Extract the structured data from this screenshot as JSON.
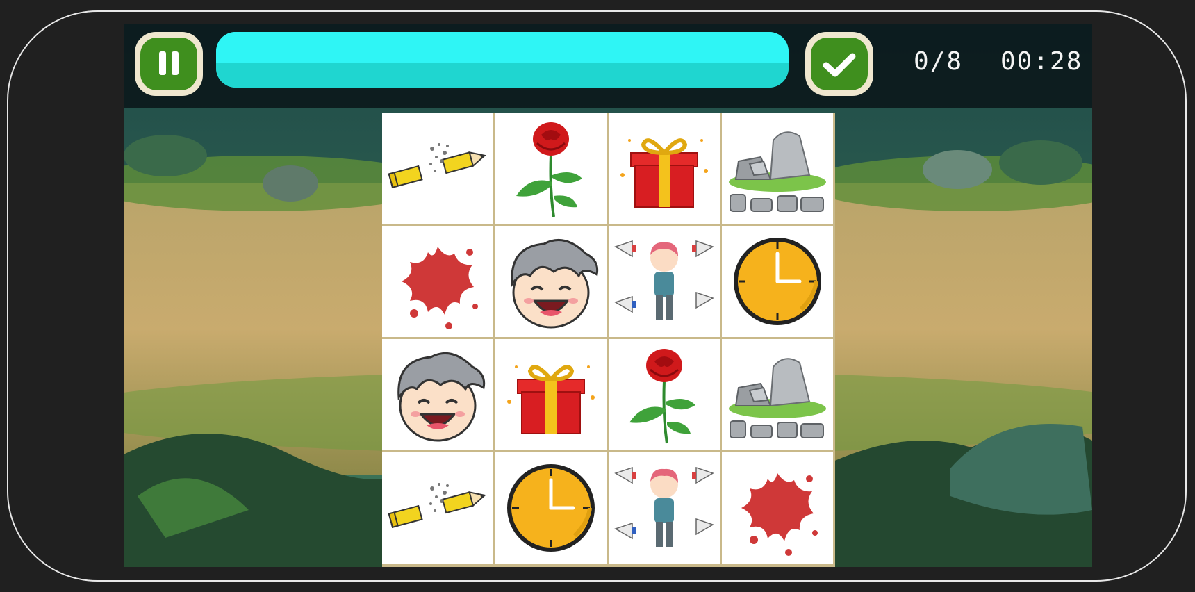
{
  "hud": {
    "matched": "0/8",
    "timer": "00:28",
    "progress_fraction": 1.0,
    "pause_icon": "pause-icon",
    "confirm_icon": "checkmark-icon"
  },
  "colors": {
    "button_green": "#3f8f1e",
    "button_frame": "#efe7cf",
    "progress_cyan": "#20e0e0"
  },
  "cards": [
    {
      "icon": "broken-pencil"
    },
    {
      "icon": "red-rose"
    },
    {
      "icon": "gift-box"
    },
    {
      "icon": "rocks"
    },
    {
      "icon": "paint-splash"
    },
    {
      "icon": "laughing-boy-face"
    },
    {
      "icon": "boy-with-megaphones"
    },
    {
      "icon": "clock"
    },
    {
      "icon": "laughing-boy-face"
    },
    {
      "icon": "gift-box"
    },
    {
      "icon": "red-rose"
    },
    {
      "icon": "rocks"
    },
    {
      "icon": "broken-pencil"
    },
    {
      "icon": "clock"
    },
    {
      "icon": "boy-with-megaphones"
    },
    {
      "icon": "paint-splash"
    }
  ]
}
